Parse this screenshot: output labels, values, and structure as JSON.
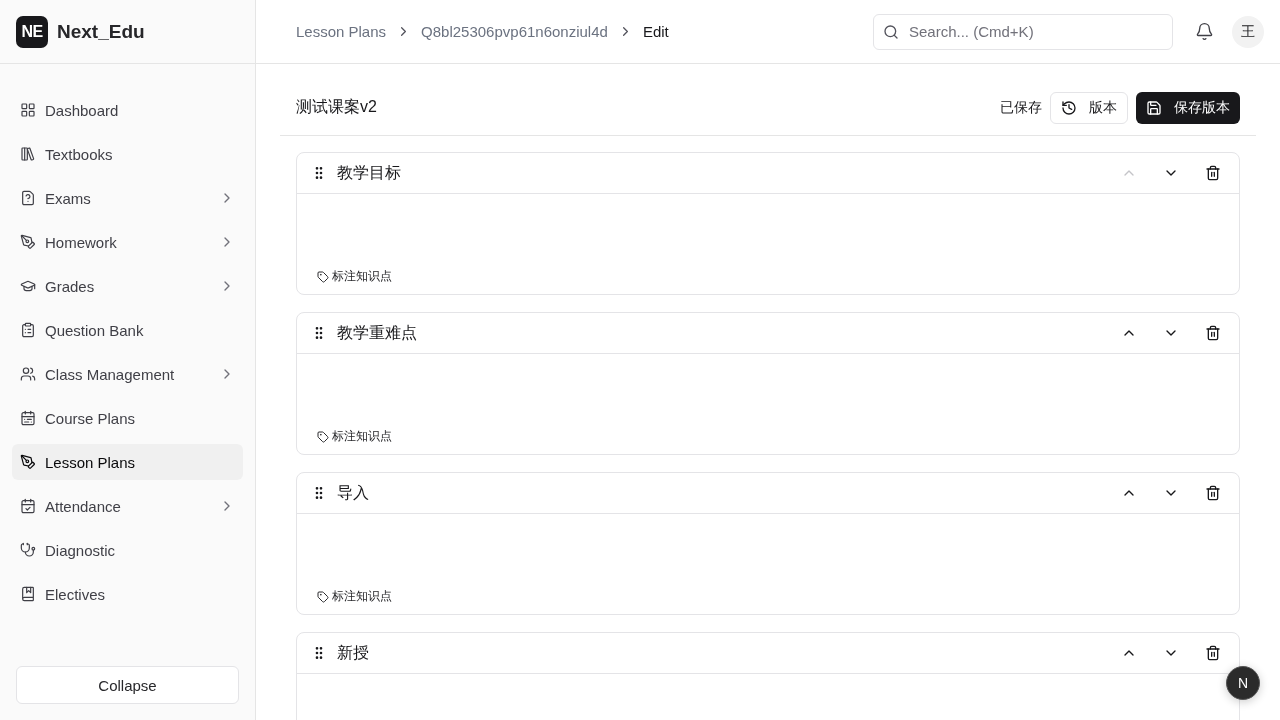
{
  "brand": {
    "logo": "NE",
    "name": "Next_Edu"
  },
  "sidebar": {
    "items": [
      {
        "label": "Dashboard",
        "selected": false,
        "has_children": false
      },
      {
        "label": "Textbooks",
        "selected": false,
        "has_children": false
      },
      {
        "label": "Exams",
        "selected": false,
        "has_children": true
      },
      {
        "label": "Homework",
        "selected": false,
        "has_children": true
      },
      {
        "label": "Grades",
        "selected": false,
        "has_children": true
      },
      {
        "label": "Question Bank",
        "selected": false,
        "has_children": false
      },
      {
        "label": "Class Management",
        "selected": false,
        "has_children": true
      },
      {
        "label": "Course Plans",
        "selected": false,
        "has_children": false
      },
      {
        "label": "Lesson Plans",
        "selected": true,
        "has_children": false
      },
      {
        "label": "Attendance",
        "selected": false,
        "has_children": true
      },
      {
        "label": "Diagnostic",
        "selected": false,
        "has_children": false
      },
      {
        "label": "Electives",
        "selected": false,
        "has_children": false
      }
    ],
    "collapse": "Collapse"
  },
  "breadcrumbs": [
    "Lesson Plans",
    "Q8bl25306pvp61n6onziul4d",
    "Edit"
  ],
  "search": {
    "placeholder": "Search... (Cmd+K)"
  },
  "avatar": "王",
  "editor": {
    "title": "测试课案v2",
    "status": "已保存",
    "versions_button": "版本",
    "save_button": "保存版本",
    "sections": [
      {
        "title": "教学目标",
        "up_disabled": true,
        "tag_button": "标注知识点"
      },
      {
        "title": "教学重难点",
        "up_disabled": false,
        "tag_button": "标注知识点"
      },
      {
        "title": "导入",
        "up_disabled": false,
        "tag_button": "标注知识点"
      },
      {
        "title": "新授",
        "up_disabled": false
      }
    ]
  },
  "dev_badge": "N"
}
